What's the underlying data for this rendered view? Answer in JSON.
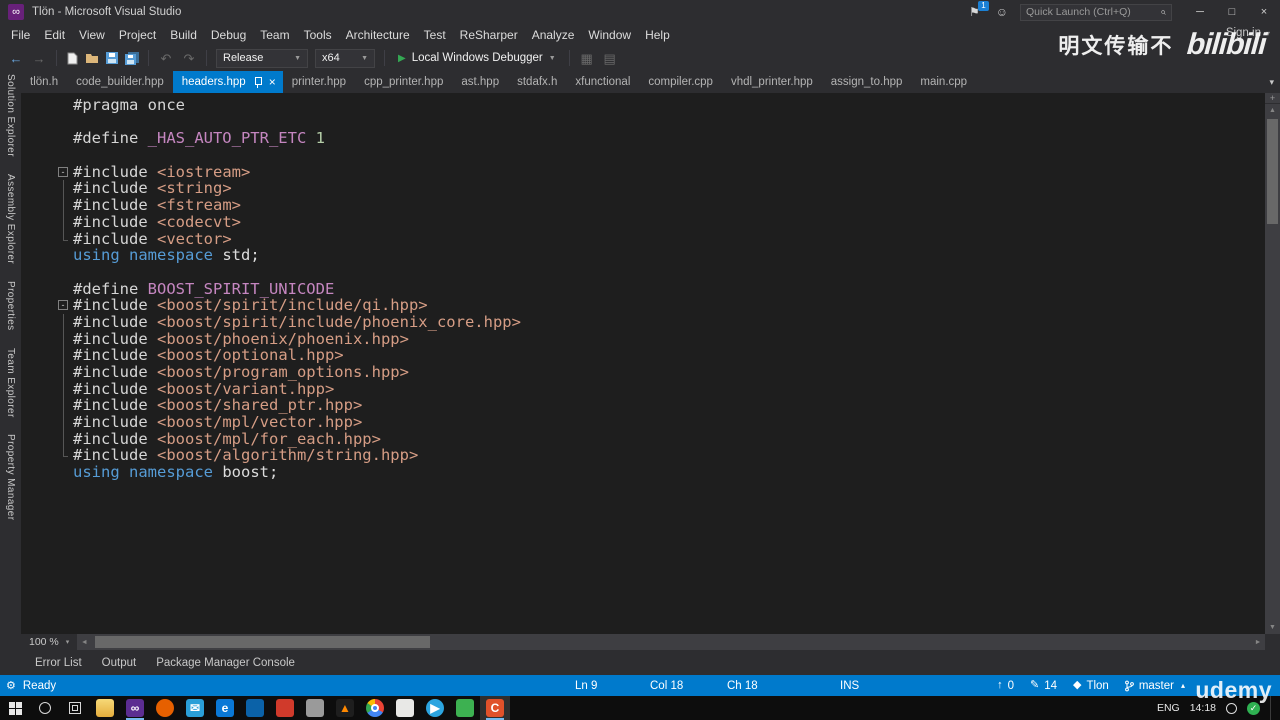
{
  "colors": {
    "accent": "#007acc",
    "shell_bg": "#2d2d30",
    "editor_bg": "#1e1e1e",
    "statusbar_bg": "#007acc",
    "taskbar_bg": "#0d0d0d",
    "active_tab_bg": "#007acc",
    "keyword": "#569cd6",
    "macro": "#c586c0",
    "string": "#d69d85",
    "preprocessor": "#d6d6d6",
    "number": "#b5cea8"
  },
  "title_bar": {
    "title": "Tlön - Microsoft Visual Studio",
    "notification_badge": "1",
    "quick_launch_placeholder": "Quick Launch (Ctrl+Q)"
  },
  "watermarks": {
    "uploader": "明文传输不",
    "platform_logo": "bilibili",
    "course_platform": "udemy"
  },
  "menu_bar": {
    "items": [
      "File",
      "Edit",
      "View",
      "Project",
      "Build",
      "Debug",
      "Team",
      "Tools",
      "Architecture",
      "Test",
      "ReSharper",
      "Analyze",
      "Window",
      "Help"
    ],
    "sign_in_label": "Sign in"
  },
  "toolbar": {
    "configuration": "Release",
    "platform": "x64",
    "debug_button": "Local Windows Debugger"
  },
  "side_tool_tabs": [
    "Solution Explorer",
    "Assembly Explorer",
    "Properties",
    "Team Explorer",
    "Property Manager"
  ],
  "editor_tabs": [
    {
      "label": "tlön.h",
      "active": false
    },
    {
      "label": "code_builder.hpp",
      "active": false
    },
    {
      "label": "headers.hpp",
      "active": true
    },
    {
      "label": "printer.hpp",
      "active": false
    },
    {
      "label": "cpp_printer.hpp",
      "active": false
    },
    {
      "label": "ast.hpp",
      "active": false
    },
    {
      "label": "stdafx.h",
      "active": false
    },
    {
      "label": "xfunctional",
      "active": false
    },
    {
      "label": "compiler.cpp",
      "active": false
    },
    {
      "label": "vhdl_printer.hpp",
      "active": false
    },
    {
      "label": "assign_to.hpp",
      "active": false
    },
    {
      "label": "main.cpp",
      "active": false
    }
  ],
  "editor": {
    "zoom_level": "100 %",
    "lines": [
      {
        "tokens": [
          {
            "t": "#pragma once",
            "c": "pp"
          }
        ]
      },
      {
        "tokens": []
      },
      {
        "tokens": [
          {
            "t": "#define ",
            "c": "pp"
          },
          {
            "t": "_HAS_AUTO_PTR_ETC",
            "c": "macro"
          },
          {
            "t": " ",
            "c": "pp"
          },
          {
            "t": "1",
            "c": "num"
          }
        ]
      },
      {
        "tokens": []
      },
      {
        "fold": "start",
        "tokens": [
          {
            "t": "#include ",
            "c": "pp"
          },
          {
            "t": "<iostream>",
            "c": "str"
          }
        ]
      },
      {
        "fold": "mid",
        "tokens": [
          {
            "t": "#include ",
            "c": "pp"
          },
          {
            "t": "<string>",
            "c": "str"
          }
        ]
      },
      {
        "fold": "mid",
        "tokens": [
          {
            "t": "#include ",
            "c": "pp"
          },
          {
            "t": "<fstream>",
            "c": "str"
          }
        ]
      },
      {
        "fold": "mid",
        "tokens": [
          {
            "t": "#include ",
            "c": "pp"
          },
          {
            "t": "<codecvt>",
            "c": "str"
          }
        ]
      },
      {
        "fold": "end",
        "tokens": [
          {
            "t": "#include ",
            "c": "pp"
          },
          {
            "t": "<vector>",
            "c": "str"
          }
        ]
      },
      {
        "tokens": [
          {
            "t": "using",
            "c": "kw"
          },
          {
            "t": " ",
            "c": "id"
          },
          {
            "t": "namespace",
            "c": "kw"
          },
          {
            "t": " std;",
            "c": "id"
          }
        ]
      },
      {
        "tokens": []
      },
      {
        "tokens": [
          {
            "t": "#define ",
            "c": "pp"
          },
          {
            "t": "BOOST_SPIRIT_UNICODE",
            "c": "macro"
          }
        ]
      },
      {
        "fold": "start",
        "tokens": [
          {
            "t": "#include ",
            "c": "pp"
          },
          {
            "t": "<boost/spirit/include/qi.hpp>",
            "c": "str"
          }
        ]
      },
      {
        "fold": "mid",
        "tokens": [
          {
            "t": "#include ",
            "c": "pp"
          },
          {
            "t": "<boost/spirit/include/phoenix_core.hpp>",
            "c": "str"
          }
        ]
      },
      {
        "fold": "mid",
        "tokens": [
          {
            "t": "#include ",
            "c": "pp"
          },
          {
            "t": "<boost/phoenix/phoenix.hpp>",
            "c": "str"
          }
        ]
      },
      {
        "fold": "mid",
        "tokens": [
          {
            "t": "#include ",
            "c": "pp"
          },
          {
            "t": "<boost/optional.hpp>",
            "c": "str"
          }
        ]
      },
      {
        "fold": "mid",
        "tokens": [
          {
            "t": "#include ",
            "c": "pp"
          },
          {
            "t": "<boost/program_options.hpp>",
            "c": "str"
          }
        ]
      },
      {
        "fold": "mid",
        "tokens": [
          {
            "t": "#include ",
            "c": "pp"
          },
          {
            "t": "<boost/variant.hpp>",
            "c": "str"
          }
        ]
      },
      {
        "fold": "mid",
        "tokens": [
          {
            "t": "#include ",
            "c": "pp"
          },
          {
            "t": "<boost/shared_ptr.hpp>",
            "c": "str"
          }
        ]
      },
      {
        "fold": "mid",
        "tokens": [
          {
            "t": "#include ",
            "c": "pp"
          },
          {
            "t": "<boost/mpl/vector.hpp>",
            "c": "str"
          }
        ]
      },
      {
        "fold": "mid",
        "tokens": [
          {
            "t": "#include ",
            "c": "pp"
          },
          {
            "t": "<boost/mpl/for_each.hpp>",
            "c": "str"
          }
        ]
      },
      {
        "fold": "end",
        "tokens": [
          {
            "t": "#include ",
            "c": "pp"
          },
          {
            "t": "<boost/algorithm/string.hpp>",
            "c": "str"
          }
        ]
      },
      {
        "tokens": [
          {
            "t": "using",
            "c": "kw"
          },
          {
            "t": " ",
            "c": "id"
          },
          {
            "t": "namespace",
            "c": "kw"
          },
          {
            "t": " boost;",
            "c": "id"
          }
        ]
      }
    ]
  },
  "bottom_panel_tabs": [
    "Error List",
    "Output",
    "Package Manager Console"
  ],
  "status_bar": {
    "state": "Ready",
    "line": "Ln 9",
    "column": "Col 18",
    "character": "Ch 18",
    "insert_mode": "INS",
    "commits_ahead": "0",
    "pending_edits": "14",
    "repository": "Tlon",
    "branch": "master"
  },
  "taskbar": {
    "language": "ENG",
    "time": "14:18",
    "apps": [
      {
        "name": "file-explorer",
        "bg": "linear-gradient(#f7d978,#e5ad3c)",
        "glyph": "",
        "fg": "#fff"
      },
      {
        "name": "visual-studio",
        "bg": "#5c2d91",
        "glyph": "∞",
        "fg": "#ffffff",
        "running": true
      },
      {
        "name": "firefox",
        "bg": "#e66000",
        "glyph": "",
        "fg": "#fff",
        "round": true
      },
      {
        "name": "mail",
        "bg": "#2a9fd8",
        "glyph": "✉",
        "fg": "#fff"
      },
      {
        "name": "edge",
        "bg": "#0a78d6",
        "glyph": "e",
        "fg": "#fff"
      },
      {
        "name": "store",
        "bg": "#0b62a8",
        "glyph": "",
        "fg": "#fff"
      },
      {
        "name": "app-red",
        "bg": "#d03a2b",
        "glyph": "",
        "fg": "#fff"
      },
      {
        "name": "app-gray",
        "bg": "#9a9a9a",
        "glyph": "",
        "fg": "#fff"
      },
      {
        "name": "vlc",
        "bg": "#1e1e1e",
        "glyph": "▲",
        "fg": "#ff8800"
      },
      {
        "name": "chrome",
        "chrome": true,
        "round": true
      },
      {
        "name": "notepad",
        "bg": "#e8e8e6",
        "glyph": "",
        "fg": "#555"
      },
      {
        "name": "telegram",
        "bg": "#2ca5e0",
        "glyph": "▶",
        "fg": "#fff",
        "round": true
      },
      {
        "name": "wechat",
        "bg": "#3db151",
        "glyph": "",
        "fg": "#fff"
      },
      {
        "name": "recorder",
        "bg": "#e0512a",
        "glyph": "C",
        "fg": "#fff",
        "running": true,
        "active": true
      }
    ]
  }
}
